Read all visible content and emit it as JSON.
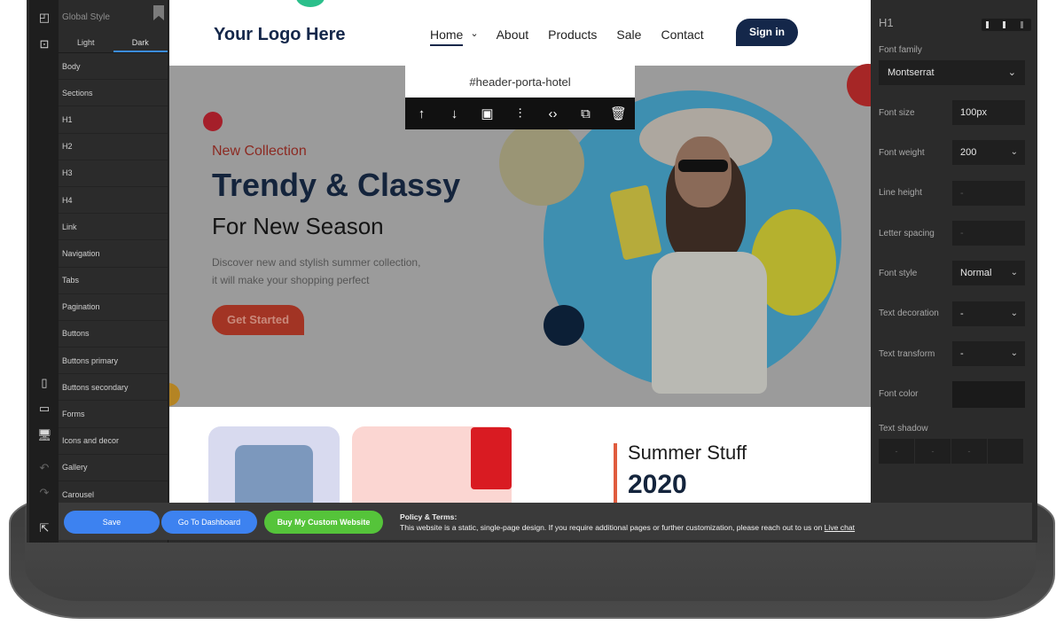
{
  "left_rail": {
    "icons": [
      "add-widget-icon",
      "add-page-icon",
      "mobile-icon",
      "tablet-icon",
      "desktop-icon",
      "arrow-icon",
      "arrow-icon",
      "export-icon"
    ]
  },
  "style_panel": {
    "title": "Global Style",
    "tabs": [
      "Light",
      "Dark"
    ],
    "items": [
      "Body",
      "Sections",
      "H1",
      "H2",
      "H3",
      "H4",
      "Link",
      "Navigation",
      "Tabs",
      "Pagination",
      "Buttons",
      "Buttons primary",
      "Buttons secondary",
      "Forms",
      "Icons and decor",
      "Gallery",
      "Carousel"
    ]
  },
  "site": {
    "logo": "Your Logo Here",
    "nav": [
      "Home",
      "About",
      "Products",
      "Sale",
      "Contact"
    ],
    "signin": "Sign in",
    "hero": {
      "subtitle": "New Collection",
      "title": "Trendy & Classy",
      "season": "For New Season",
      "desc1": "Discover new and stylish summer collection,",
      "desc2": "it will make your shopping perfect",
      "cta": "Get Started"
    },
    "summer": {
      "title": "Summer Stuff",
      "year": "2020"
    }
  },
  "element_toolbar": {
    "selector": "#header-porta-hotel",
    "actions": [
      "move-up",
      "move-down",
      "image",
      "settings",
      "code",
      "duplicate",
      "delete"
    ]
  },
  "props": {
    "heading": "H1",
    "font_family_label": "Font family",
    "font_family": "Montserrat",
    "font_size_label": "Font size",
    "font_size": "100px",
    "font_weight_label": "Font weight",
    "font_weight": "200",
    "line_height_label": "Line height",
    "line_height": "-",
    "letter_spacing_label": "Letter spacing",
    "letter_spacing": "-",
    "font_style_label": "Font style",
    "font_style": "Normal",
    "text_decoration_label": "Text decoration",
    "text_decoration": "-",
    "text_transform_label": "Text transform",
    "text_transform": "-",
    "font_color_label": "Font color",
    "text_shadow_label": "Text shadow",
    "text_shadow": [
      "-",
      "-",
      "-"
    ]
  },
  "actionbar": {
    "save": "Save",
    "dashboard": "Go To Dashboard",
    "buy": "Buy My Custom Website",
    "policy_title": "Policy & Terms:",
    "policy_text": "This website is a static, single-page design. If you require additional pages or further customization, please reach out to us on ",
    "policy_link": "Live chat"
  }
}
